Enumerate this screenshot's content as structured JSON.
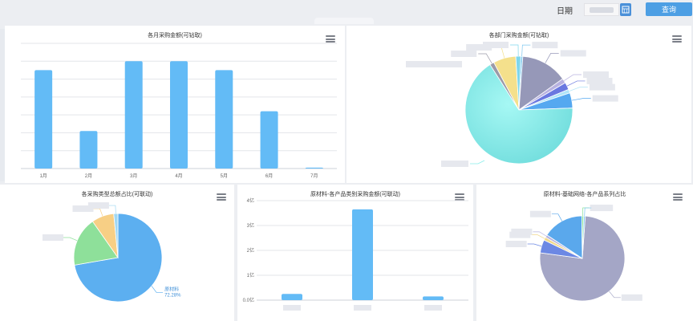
{
  "toolbar": {
    "date_label": "日期",
    "query_label": "查询",
    "calendar_icon": "calendar-icon"
  },
  "panels": {
    "p1_title": "各月采购金额(可钻取)",
    "p2_title": "各部门采购金额(可钻取)",
    "p3_title": "各采购类型总额占比(可联动)",
    "p4_title": "原材料-各产品类别采购金额(可联动)",
    "p5_title": "原材料-基础网络-各产品系列占比"
  },
  "chart_data": [
    {
      "type": "bar",
      "title": "各月采购金额(可钻取)",
      "categories": [
        "1月",
        "2月",
        "3月",
        "4月",
        "5月",
        "6月",
        "7月"
      ],
      "values": [
        5.5,
        2.1,
        6.0,
        6.0,
        5.5,
        3.2,
        0.05
      ],
      "ylim": [
        0,
        7
      ],
      "grid": true,
      "color": "#63bbf6"
    },
    {
      "type": "pie",
      "title": "各部门采购金额(可钻取)",
      "slices": [
        {
          "value": 0.6,
          "color": "#7ec8ef"
        },
        {
          "value": 14.0,
          "color": "#9698b8"
        },
        {
          "value": 1.4,
          "color": "#b8b2e0"
        },
        {
          "value": 2.2,
          "color": "#6a78e0"
        },
        {
          "value": 1.1,
          "color": "#b0e4f8"
        },
        {
          "value": 4.6,
          "color": "#55a8f0"
        },
        {
          "value": 66.5,
          "color": "#86eeea"
        },
        {
          "value": 1.3,
          "color": "#9b9aa8"
        },
        {
          "value": 6.8,
          "color": "#f4e08c"
        },
        {
          "value": 1.5,
          "color": "#7ed6ec"
        }
      ]
    },
    {
      "type": "pie",
      "title": "各采购类型总额占比(可联动)",
      "slices": [
        {
          "value": 72.28,
          "color": "#5caff0"
        },
        {
          "value": 18.0,
          "color": "#8ee09a"
        },
        {
          "value": 8.2,
          "color": "#f7cf85"
        },
        {
          "value": 1.52,
          "color": "#9fd8f4"
        }
      ],
      "labels": [
        {
          "name": "原材料",
          "value": "72.28%"
        }
      ]
    },
    {
      "type": "bar",
      "title": "原材料-各产品类别采购金额(可联动)",
      "yticks": [
        "0.0亿",
        "1亿",
        "2亿",
        "3亿",
        "4亿"
      ],
      "ylim": [
        0,
        4
      ],
      "values": [
        0.25,
        3.65,
        0.15
      ],
      "grid": true,
      "color": "#63bbf6"
    },
    {
      "type": "pie",
      "title": "原材料-基础网络-各产品系列占比",
      "slices": [
        {
          "value": 76.0,
          "color": "#a4a6c6"
        },
        {
          "value": 5.0,
          "color": "#6c88e4"
        },
        {
          "value": 1.2,
          "color": "#f2d98c"
        },
        {
          "value": 1.0,
          "color": "#b5b2de"
        },
        {
          "value": 15.5,
          "color": "#5aa8ec"
        },
        {
          "value": 0.7,
          "color": "#8ae29c"
        },
        {
          "value": 0.6,
          "color": "#7ec8ef"
        }
      ]
    }
  ]
}
